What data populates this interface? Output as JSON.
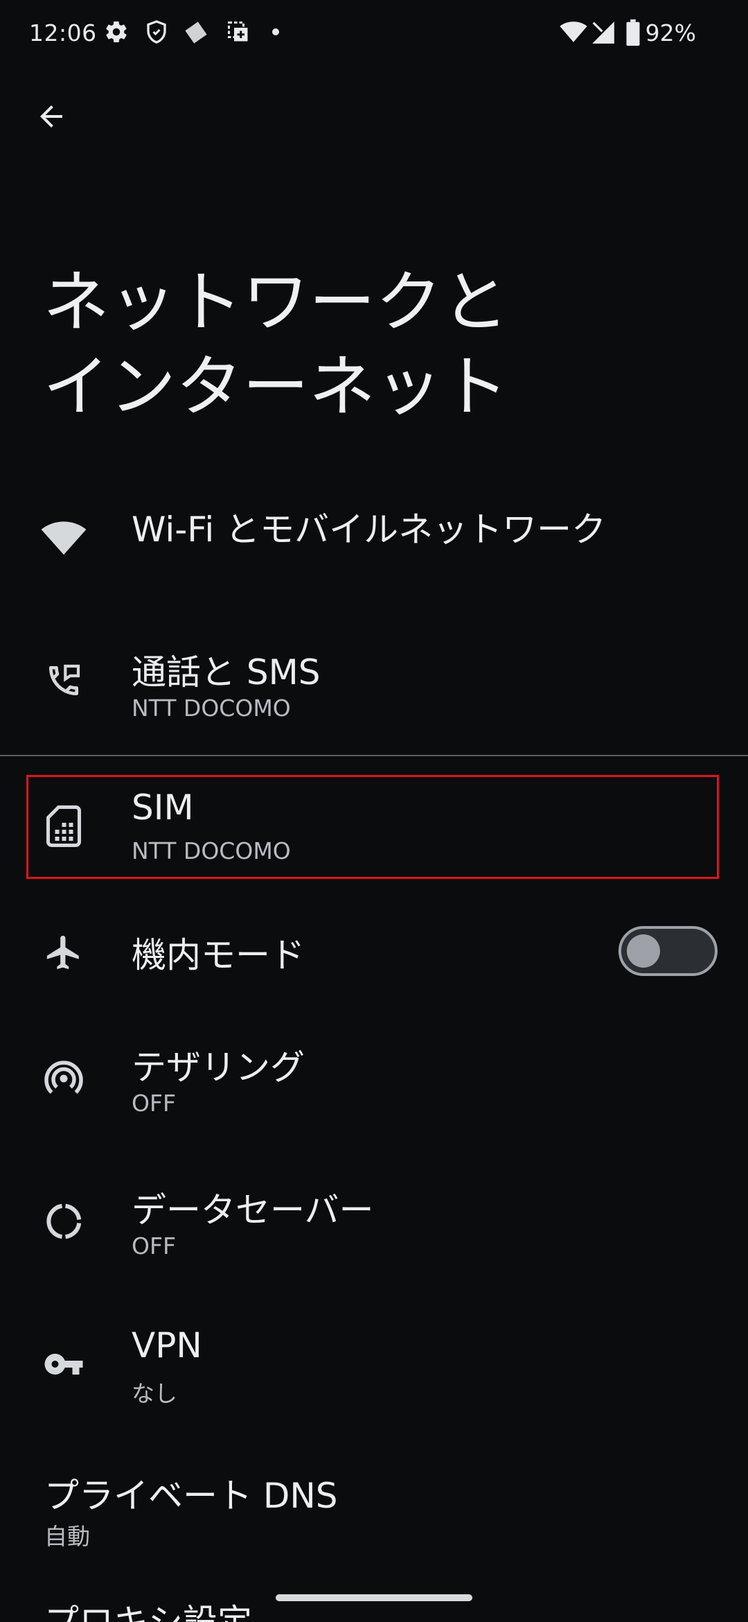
{
  "status_bar": {
    "time": "12:06",
    "battery": "92%",
    "icons": [
      "gear-icon",
      "shield-icon",
      "diamond-icon",
      "screenshot-icon",
      "dot-icon",
      "wifi-icon",
      "signal-icon",
      "battery-icon"
    ]
  },
  "header": {
    "back_icon": "arrow-back-icon",
    "title_line1": "ネットワークと",
    "title_line2": "インターネット"
  },
  "items": [
    {
      "icon": "wifi-icon",
      "title": "Wi-Fi とモバイルネットワーク",
      "subtitle": ""
    },
    {
      "icon": "phone-message-icon",
      "title": "通話と SMS",
      "subtitle": "NTT DOCOMO"
    },
    {
      "icon": "sim-card-icon",
      "title": "SIM",
      "subtitle": "NTT DOCOMO",
      "highlighted": true
    },
    {
      "icon": "airplane-icon",
      "title": "機内モード",
      "subtitle": "",
      "toggle": "off"
    },
    {
      "icon": "hotspot-icon",
      "title": "テザリング",
      "subtitle": "OFF"
    },
    {
      "icon": "data-saver-icon",
      "title": "データセーバー",
      "subtitle": "OFF"
    },
    {
      "icon": "vpn-key-icon",
      "title": "VPN",
      "subtitle": "なし"
    },
    {
      "icon": "",
      "title": "プライベート DNS",
      "subtitle": "自動"
    },
    {
      "icon": "",
      "title": "プロキシ設定",
      "subtitle": ""
    }
  ],
  "colors": {
    "background": "#0b0c0e",
    "highlight": "#e0141e",
    "text": "#eceef0",
    "subtext": "#b8bcc2"
  }
}
